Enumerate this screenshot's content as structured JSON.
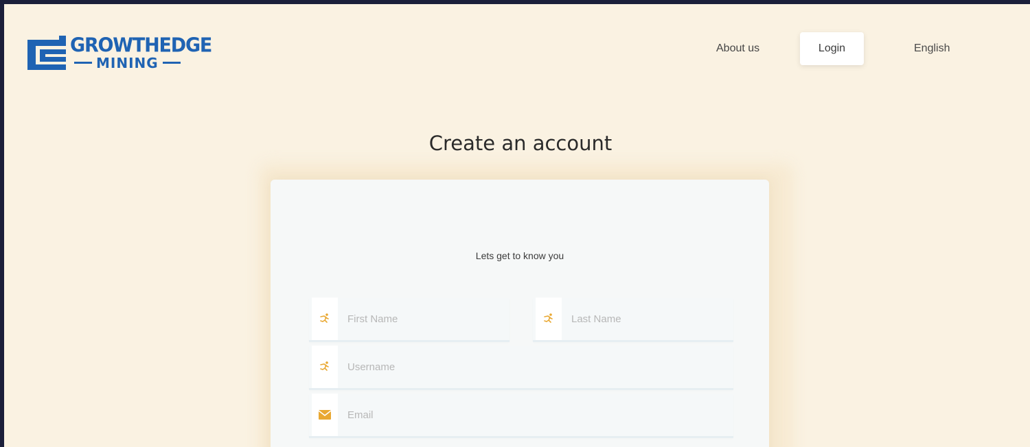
{
  "brand": {
    "name_line1": "GROWTHEDGE",
    "name_line2": "MINING",
    "color": "#1f63b3"
  },
  "nav": {
    "about": "About us",
    "login": "Login",
    "language": "English"
  },
  "page": {
    "title": "Create an account"
  },
  "form": {
    "subtitle": "Lets get to know you",
    "accent_color": "#e9a832",
    "fields": {
      "first_name": {
        "placeholder": "First Name",
        "value": "",
        "icon": "running-person-icon"
      },
      "last_name": {
        "placeholder": "Last Name",
        "value": "",
        "icon": "running-person-icon"
      },
      "username": {
        "placeholder": "Username",
        "value": "",
        "icon": "running-person-icon"
      },
      "email": {
        "placeholder": "Email",
        "value": "",
        "icon": "envelope-icon"
      }
    }
  }
}
